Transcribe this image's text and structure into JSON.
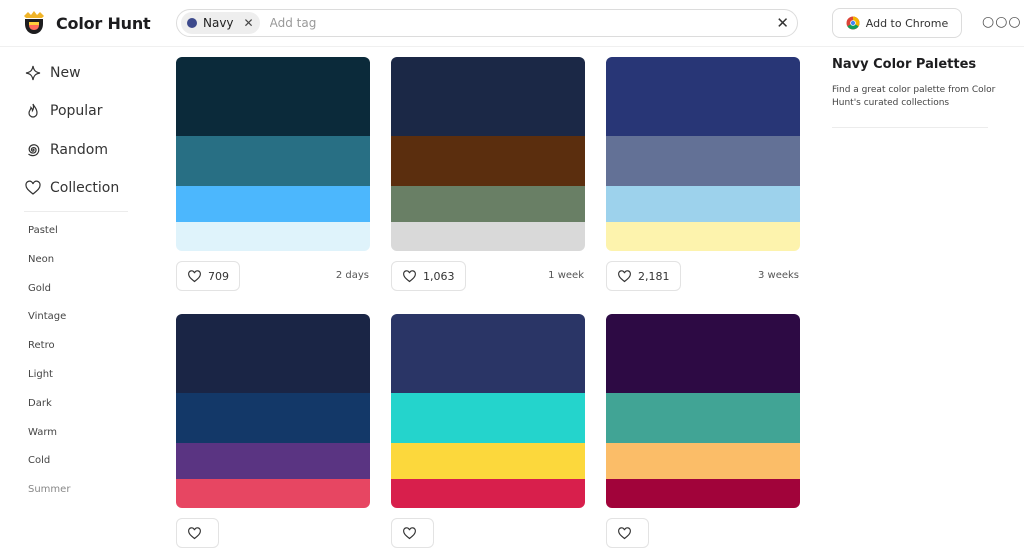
{
  "header": {
    "app_name": "Color Hunt",
    "search_tag": "Navy",
    "search_placeholder": "Add tag",
    "chrome_button": "Add to Chrome"
  },
  "sidebar": {
    "nav": [
      "New",
      "Popular",
      "Random",
      "Collection"
    ],
    "tags": [
      "Pastel",
      "Neon",
      "Gold",
      "Vintage",
      "Retro",
      "Light",
      "Dark",
      "Warm",
      "Cold",
      "Summer"
    ]
  },
  "panel": {
    "title": "Navy Color Palettes",
    "description": "Find a great color palette from Color Hunt's curated collections"
  },
  "palettes": [
    {
      "colors": [
        "#0b2a3a",
        "#286f84",
        "#4cb7fd",
        "#dff3fb"
      ],
      "likes": "709",
      "time": "2 days"
    },
    {
      "colors": [
        "#1b2846",
        "#5b2e0e",
        "#697f65",
        "#d9d9d9"
      ],
      "likes": "1,063",
      "time": "1 week"
    },
    {
      "colors": [
        "#283676",
        "#637196",
        "#9dd2ec",
        "#fdf3ad"
      ],
      "likes": "2,181",
      "time": "3 weeks"
    },
    {
      "colors": [
        "#1a2545",
        "#133868",
        "#5a3482",
        "#e74662"
      ],
      "likes": "",
      "time": ""
    },
    {
      "colors": [
        "#2a3566",
        "#24d4cc",
        "#fcd83c",
        "#d81f4c"
      ],
      "likes": "",
      "time": ""
    },
    {
      "colors": [
        "#2d0a44",
        "#41a495",
        "#fbbd68",
        "#a1033a"
      ],
      "likes": "",
      "time": ""
    }
  ],
  "colors": {
    "tag_dot": "#3d4a8c",
    "border": "#dcdcdc"
  }
}
